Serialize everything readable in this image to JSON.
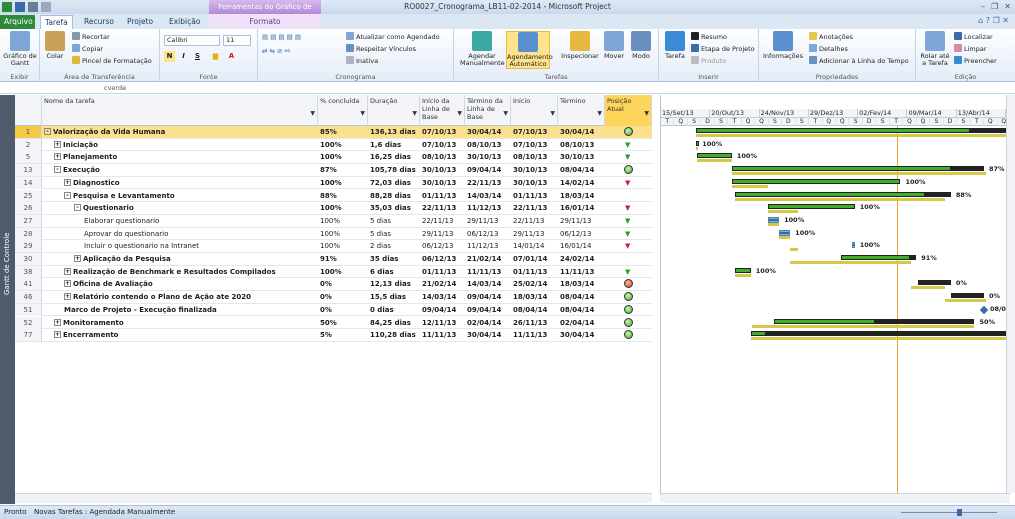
{
  "window": {
    "title": "RO0027_Cronograma_LB11-02-2014 - Microsoft Project",
    "context_group": "Ferramentas do Gráfico de Gantt"
  },
  "tabs": {
    "file": "Arquivo",
    "items": [
      "Tarefa",
      "Recurso",
      "Projeto",
      "Exibição"
    ],
    "context_tab": "Formato"
  },
  "ribbon": {
    "groups": {
      "exibir": "Exibir",
      "transferencia": "Área de Transferência",
      "fonte": "Fonte",
      "cronograma": "Cronograma",
      "tarefas": "Tarefas",
      "inserir": "Inserir",
      "propriedades": "Propriedades",
      "edicao": "Edição"
    },
    "buttons": {
      "gantt_chart": "Gráfico de Gantt",
      "paste": "Colar",
      "cut": "Recortar",
      "copy": "Copiar",
      "format_painter": "Pincel de Formatação",
      "font_name": "Calibri",
      "font_size": "11",
      "bold": "N",
      "italic": "I",
      "underline": "S",
      "update_as_scheduled": "Atualizar como Agendado",
      "respect_links": "Respeitar Vínculos",
      "inactivate": "Inativa",
      "manual_schedule": "Agendar Manualmente",
      "auto_schedule": "Agendamento Automático",
      "inspect": "Inspecionar",
      "move": "Mover",
      "mode": "Modo",
      "task": "Tarefa",
      "summary": "Resumo",
      "milestone": "Etapa de Projeto",
      "deliverable": "Produto",
      "information": "Informações",
      "notes": "Anotações",
      "details": "Detalhes",
      "add_to_timeline": "Adicionar à Linha do Tempo",
      "scroll_to_task": "Rolar até a Tarefa",
      "find": "Localizar",
      "clear": "Limpar",
      "fill": "Preencher"
    }
  },
  "formula_bar": {
    "value": "cverde"
  },
  "side_label": "Gantt de Controle",
  "table": {
    "columns": {
      "name": "Nome da tarefa",
      "pct": "% concluída",
      "duration": "Duração",
      "baseline_start": "Início da Linha de Base",
      "baseline_finish": "Término da Linha de Base",
      "start": "Início",
      "finish": "Término",
      "status": "Posição Atual"
    },
    "rows": [
      {
        "id": "1",
        "name": "Valorização da Vida Humana",
        "pct": "85%",
        "dur": "136,13 dias",
        "bs": "07/10/13",
        "bf": "30/04/14",
        "start": "07/10/13",
        "finish": "30/04/14",
        "status": "green-circle",
        "level": 0,
        "bold": true,
        "exp": "-"
      },
      {
        "id": "2",
        "name": "Iniciação",
        "pct": "100%",
        "dur": "1,6 dias",
        "bs": "07/10/13",
        "bf": "08/10/13",
        "start": "07/10/13",
        "finish": "08/10/13",
        "status": "green-flag",
        "level": 1,
        "bold": true,
        "exp": "+"
      },
      {
        "id": "5",
        "name": "Planejamento",
        "pct": "100%",
        "dur": "16,25 dias",
        "bs": "08/10/13",
        "bf": "30/10/13",
        "start": "08/10/13",
        "finish": "30/10/13",
        "status": "green-flag",
        "level": 1,
        "bold": true,
        "exp": "+"
      },
      {
        "id": "13",
        "name": "Execução",
        "pct": "87%",
        "dur": "105,78 dias",
        "bs": "30/10/13",
        "bf": "09/04/14",
        "start": "30/10/13",
        "finish": "08/04/14",
        "status": "green-circle",
        "level": 1,
        "bold": true,
        "exp": "-"
      },
      {
        "id": "14",
        "name": "Diagnostico",
        "pct": "100%",
        "dur": "72,03 dias",
        "bs": "30/10/13",
        "bf": "22/11/13",
        "start": "30/10/13",
        "finish": "14/02/14",
        "status": "red-flag",
        "level": 2,
        "bold": true,
        "exp": "+"
      },
      {
        "id": "25",
        "name": "Pesquisa e Levantamento",
        "pct": "88%",
        "dur": "88,28 dias",
        "bs": "01/11/13",
        "bf": "14/03/14",
        "start": "01/11/13",
        "finish": "18/03/14",
        "status": "",
        "level": 2,
        "bold": true,
        "exp": "-"
      },
      {
        "id": "26",
        "name": "Questionario",
        "pct": "100%",
        "dur": "35,03 dias",
        "bs": "22/11/13",
        "bf": "11/12/13",
        "start": "22/11/13",
        "finish": "16/01/14",
        "status": "red-flag",
        "level": 3,
        "bold": true,
        "exp": "-"
      },
      {
        "id": "27",
        "name": "Elaborar questionario",
        "pct": "100%",
        "dur": "5 dias",
        "bs": "22/11/13",
        "bf": "29/11/13",
        "start": "22/11/13",
        "finish": "29/11/13",
        "status": "green-flag",
        "level": 4,
        "bold": false,
        "exp": ""
      },
      {
        "id": "28",
        "name": "Aprovar do questionario",
        "pct": "100%",
        "dur": "5 dias",
        "bs": "29/11/13",
        "bf": "06/12/13",
        "start": "29/11/13",
        "finish": "06/12/13",
        "status": "green-flag",
        "level": 4,
        "bold": false,
        "exp": ""
      },
      {
        "id": "29",
        "name": "Incluir o questionario na Intranet",
        "pct": "100%",
        "dur": "2 dias",
        "bs": "06/12/13",
        "bf": "11/12/13",
        "start": "14/01/14",
        "finish": "16/01/14",
        "status": "red-flag",
        "level": 4,
        "bold": false,
        "exp": ""
      },
      {
        "id": "30",
        "name": "Aplicação da Pesquisa",
        "pct": "91%",
        "dur": "35 dias",
        "bs": "06/12/13",
        "bf": "21/02/14",
        "start": "07/01/14",
        "finish": "24/02/14",
        "status": "",
        "level": 3,
        "bold": true,
        "exp": "+"
      },
      {
        "id": "38",
        "name": "Realização de Benchmark e Resultados Compilados",
        "pct": "100%",
        "dur": "6 dias",
        "bs": "01/11/13",
        "bf": "11/11/13",
        "start": "01/11/13",
        "finish": "11/11/13",
        "status": "green-flag",
        "level": 2,
        "bold": true,
        "exp": "+"
      },
      {
        "id": "41",
        "name": "Oficina de Avaliação",
        "pct": "0%",
        "dur": "12,13 dias",
        "bs": "21/02/14",
        "bf": "14/03/14",
        "start": "25/02/14",
        "finish": "18/03/14",
        "status": "red-circle",
        "level": 2,
        "bold": true,
        "exp": "+"
      },
      {
        "id": "46",
        "name": "Relatório contendo o Plano de Ação ate 2020",
        "pct": "0%",
        "dur": "15,5 dias",
        "bs": "14/03/14",
        "bf": "09/04/14",
        "start": "18/03/14",
        "finish": "08/04/14",
        "status": "green-circle",
        "level": 2,
        "bold": true,
        "exp": "+"
      },
      {
        "id": "51",
        "name": "Marco de Projeto - Execução finalizada",
        "pct": "0%",
        "dur": "0 dias",
        "bs": "09/04/14",
        "bf": "09/04/14",
        "start": "08/04/14",
        "finish": "08/04/14",
        "status": "green-circle",
        "level": 2,
        "bold": true,
        "exp": ""
      },
      {
        "id": "52",
        "name": "Monitoramento",
        "pct": "50%",
        "dur": "84,25 dias",
        "bs": "12/11/13",
        "bf": "02/04/14",
        "start": "26/11/13",
        "finish": "02/04/14",
        "status": "green-circle",
        "level": 1,
        "bold": true,
        "exp": "+"
      },
      {
        "id": "77",
        "name": "Encerramento",
        "pct": "5%",
        "dur": "110,28 dias",
        "bs": "11/11/13",
        "bf": "30/04/14",
        "start": "11/11/13",
        "finish": "30/04/14",
        "status": "green-circle",
        "level": 1,
        "bold": true,
        "exp": "+"
      }
    ]
  },
  "gantt": {
    "timescale_top": [
      "15/Set/13",
      "20/Out/13",
      "24/Nov/13",
      "29/Dez/13",
      "02/Fev/14",
      "09/Mar/14",
      "13/Abr/14",
      "18/"
    ],
    "timescale_bottom": [
      "T",
      "Q",
      "S",
      "D",
      "S",
      "T",
      "Q",
      "Q",
      "S",
      "D",
      "S",
      "T",
      "Q",
      "Q",
      "S",
      "D",
      "S",
      "T",
      "Q",
      "Q",
      "S",
      "D",
      "S",
      "T",
      "Q",
      "Q"
    ],
    "axis_start": "2013-09-15",
    "axis_end": "2014-04-22",
    "today": "2014-02-12",
    "milestone_label": "08/04"
  },
  "statusbar": {
    "ready": "Pronto",
    "new_tasks": "Novas Tarefas : Agendada Manualmente"
  },
  "colors": {
    "file_tab": "#2d8a3a",
    "selected_row": "#fbe08e",
    "highlight_header": "#fdd55a",
    "summary_bar": "#222222",
    "progress": "#3fae2a",
    "baseline": "#d8c84a",
    "today_line": "#f0a040"
  }
}
